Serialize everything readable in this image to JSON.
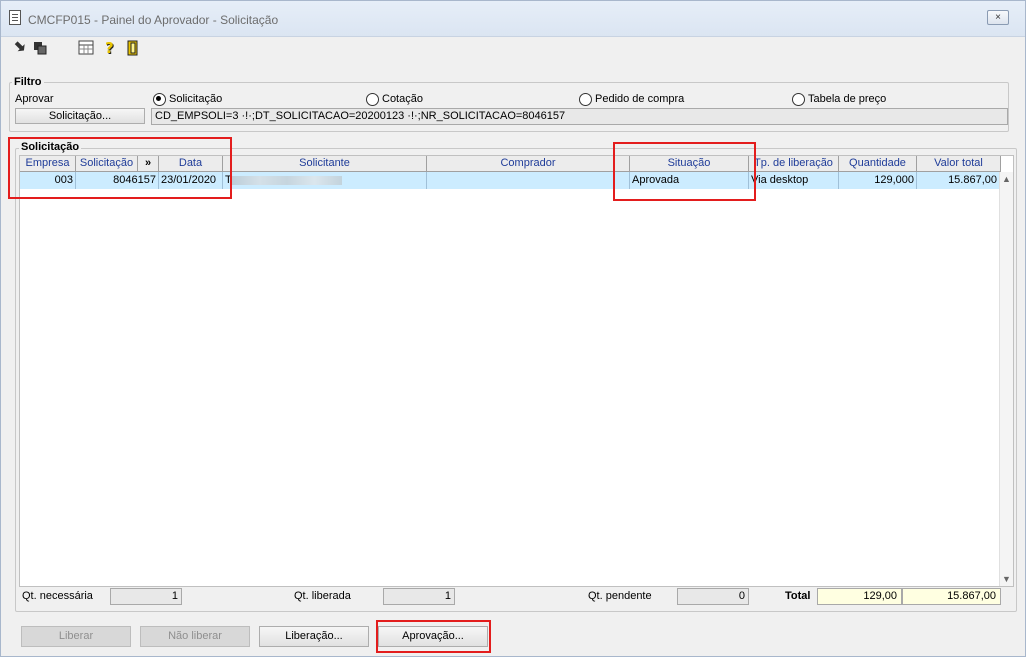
{
  "window": {
    "title": "CMCFP015 - Painel do Aprovador - Solicitação",
    "close_icon": "×"
  },
  "toolbar": {
    "icons": [
      "enter-icon",
      "copy-icon",
      "calculator-icon",
      "help-icon",
      "exit-door-icon"
    ]
  },
  "filter": {
    "group_label": "Filtro",
    "approve_label": "Aprovar",
    "radios": [
      {
        "label": "Solicitação",
        "checked": true
      },
      {
        "label": "Cotação",
        "checked": false
      },
      {
        "label": "Pedido de compra",
        "checked": false
      },
      {
        "label": "Tabela de preço",
        "checked": false
      }
    ],
    "solicitacao_button": "Solicitação...",
    "query": "CD_EMPSOLI=3 ·!·;DT_SOLICITACAO=20200123 ·!·;NR_SOLICITACAO=8046157"
  },
  "grid": {
    "group_label": "Solicitação",
    "columns": [
      "Empresa",
      "Solicitação",
      "»",
      "Data",
      "Solicitante",
      "Comprador",
      "Situação",
      "Tp. de liberação",
      "Quantidade",
      "Valor total"
    ],
    "rows": [
      {
        "empresa": "003",
        "solicitacao": "8046157",
        "data": "23/01/2020",
        "solicitante": "T",
        "comprador": "",
        "situacao": "Aprovada",
        "tp_liberacao": "Via desktop",
        "quantidade": "129,000",
        "valor_total": "15.867,00"
      }
    ]
  },
  "totals": {
    "qt_necessaria_label": "Qt. necessária",
    "qt_necessaria": "1",
    "qt_liberada_label": "Qt. liberada",
    "qt_liberada": "1",
    "qt_pendente_label": "Qt. pendente",
    "qt_pendente": "0",
    "total_label": "Total",
    "total_quantidade": "129,00",
    "total_valor": "15.867,00"
  },
  "buttons": {
    "liberar": "Liberar",
    "nao_liberar": "Não liberar",
    "liberacao": "Liberação...",
    "aprovacao": "Aprovação..."
  },
  "colors": {
    "annotation": "#e31d1d",
    "selected_row": "#ccecff",
    "header_text": "#1f3c99"
  }
}
